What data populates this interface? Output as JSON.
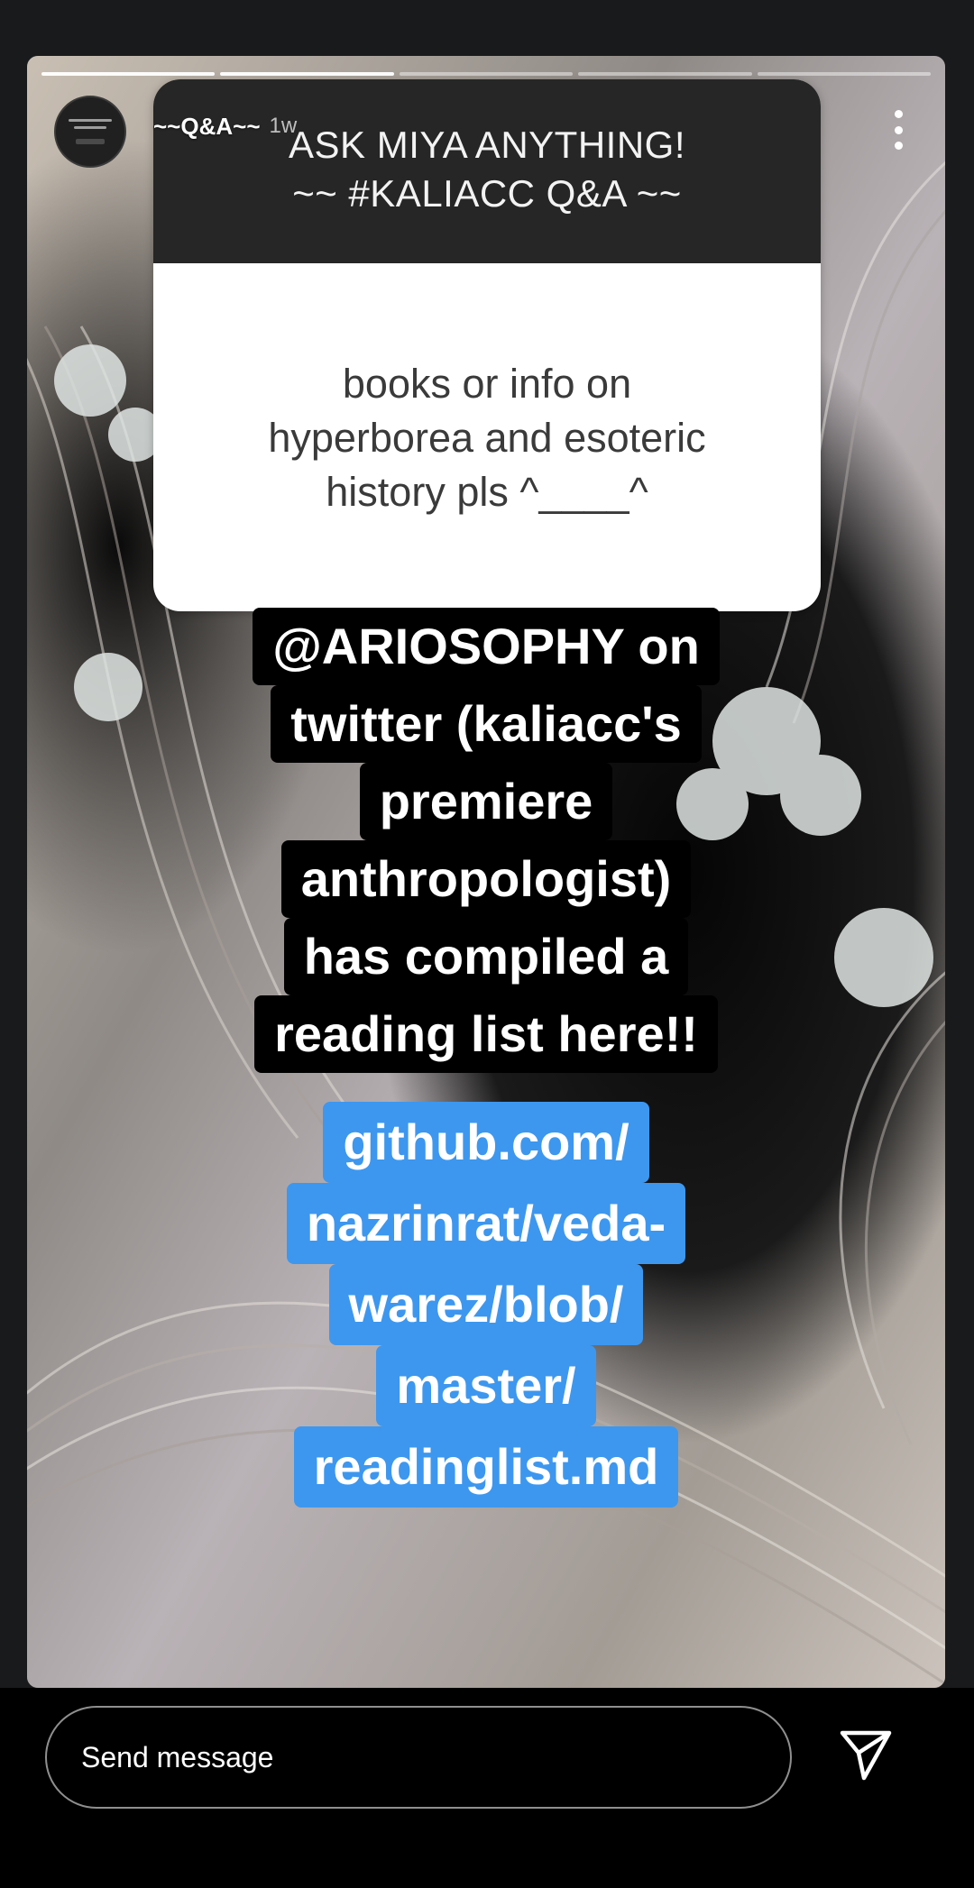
{
  "story": {
    "username": "~~Q&A~~",
    "timestamp": "1w",
    "progress_segments": 5,
    "progress_done": 2
  },
  "question_card": {
    "header_line1": "ASK MIYA ANYTHING!",
    "header_line2": "~~ #KALIACC Q&A ~~",
    "question_line1": "books or info on",
    "question_line2": "hyperborea and esoteric",
    "question_line3": "history pls ^____^"
  },
  "answer": {
    "lines": [
      "@ARIOSOPHY on",
      "twitter (kaliacc's",
      "premiere",
      "anthropologist)",
      "has compiled a",
      "reading list here!!"
    ]
  },
  "link": {
    "lines": [
      "github.com/",
      "nazrinrat/veda-",
      "warez/blob/",
      "master/",
      "readinglist.md"
    ]
  },
  "bottom_bar": {
    "message_placeholder": "Send message"
  },
  "colors": {
    "link_highlight": "#3d97ef",
    "answer_highlight": "#000000",
    "card_header": "#262626"
  },
  "icons": {
    "more": "three-dots-vertical-icon",
    "send": "paper-plane-icon"
  }
}
